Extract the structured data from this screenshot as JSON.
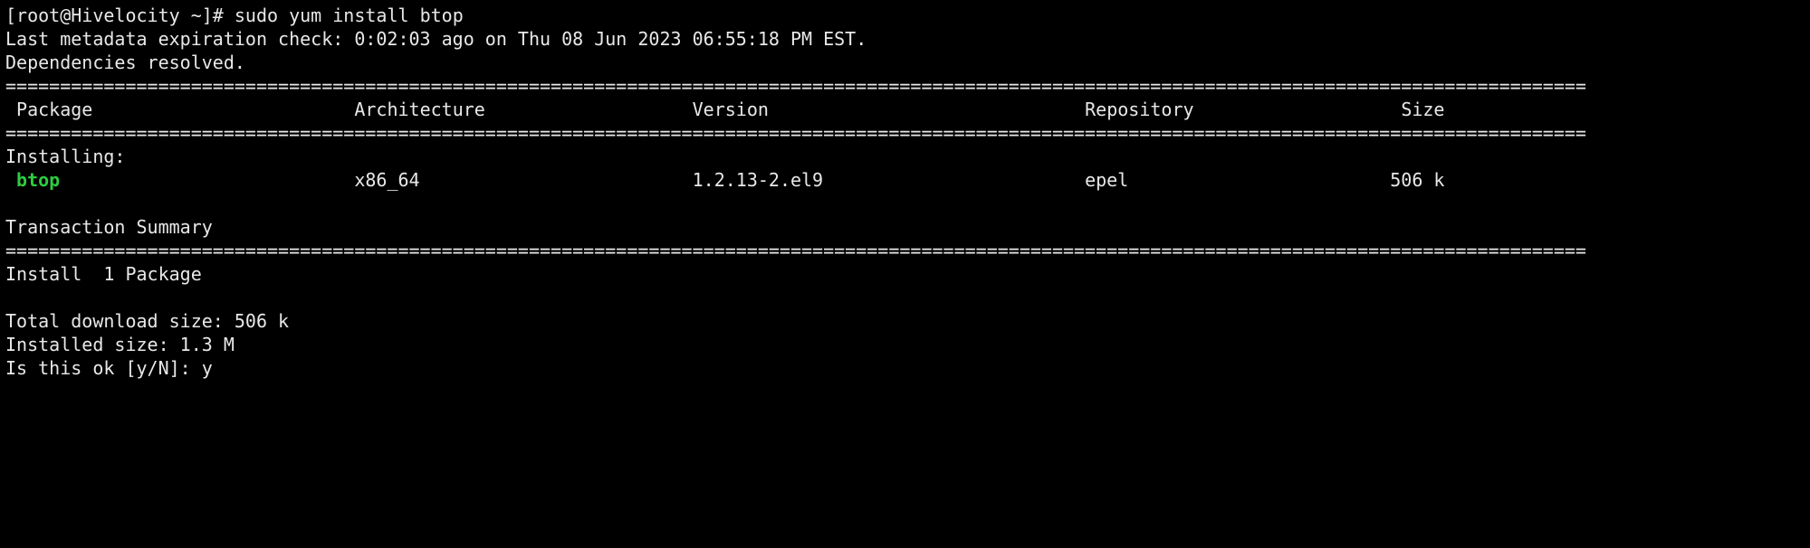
{
  "prompt": {
    "prefix": "[root@Hivelocity ~]# ",
    "command": "sudo yum install btop"
  },
  "output": {
    "metadata_check": "Last metadata expiration check: 0:02:03 ago on Thu 08 Jun 2023 06:55:18 PM EST.",
    "deps_resolved": "Dependencies resolved.",
    "installing_label": "Installing:",
    "summary_label": "Transaction Summary",
    "install_count": "Install  1 Package",
    "download_size": "Total download size: 506 k",
    "installed_size": "Installed size: 1.3 M",
    "confirm_prompt": "Is this ok [y/N]: ",
    "confirm_answer": "y"
  },
  "table": {
    "headers": {
      "package": "Package",
      "arch": "Architecture",
      "version": "Version",
      "repo": "Repository",
      "size": "Size"
    },
    "row": {
      "package": "btop",
      "arch": "x86_64",
      "version": "1.2.13-2.el9",
      "repo": "epel",
      "size": "506 k"
    }
  },
  "dividers": {
    "full": "================================================================================================================================================="
  }
}
